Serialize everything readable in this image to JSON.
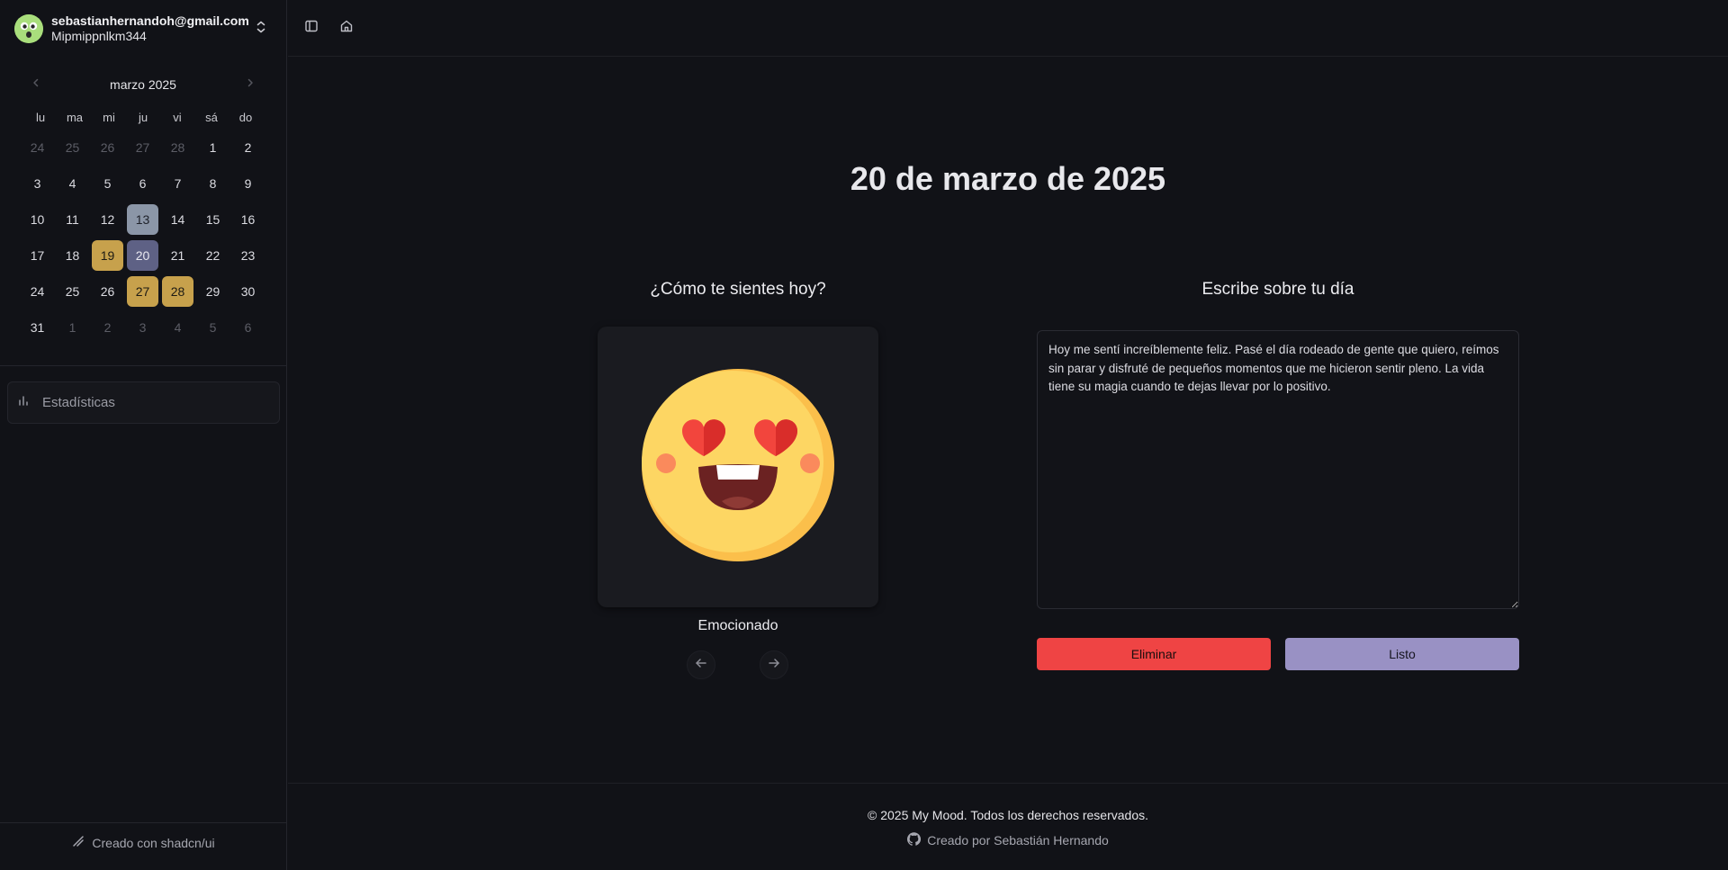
{
  "account": {
    "email": "sebastianhernandoh@gmail.com",
    "username": "Mipmippnlkm344"
  },
  "calendar": {
    "month_label": "marzo 2025",
    "weekdays": [
      "lu",
      "ma",
      "mi",
      "ju",
      "vi",
      "sá",
      "do"
    ],
    "days": [
      {
        "n": "24",
        "out": true
      },
      {
        "n": "25",
        "out": true
      },
      {
        "n": "26",
        "out": true
      },
      {
        "n": "27",
        "out": true
      },
      {
        "n": "28",
        "out": true
      },
      {
        "n": "1"
      },
      {
        "n": "2"
      },
      {
        "n": "3"
      },
      {
        "n": "4"
      },
      {
        "n": "5"
      },
      {
        "n": "6"
      },
      {
        "n": "7"
      },
      {
        "n": "8"
      },
      {
        "n": "9"
      },
      {
        "n": "10"
      },
      {
        "n": "11"
      },
      {
        "n": "12"
      },
      {
        "n": "13",
        "mood": "gray"
      },
      {
        "n": "14"
      },
      {
        "n": "15"
      },
      {
        "n": "16"
      },
      {
        "n": "17"
      },
      {
        "n": "18"
      },
      {
        "n": "19",
        "mood": "gold"
      },
      {
        "n": "20",
        "mood": "selected"
      },
      {
        "n": "21"
      },
      {
        "n": "22"
      },
      {
        "n": "23"
      },
      {
        "n": "24"
      },
      {
        "n": "25"
      },
      {
        "n": "26"
      },
      {
        "n": "27",
        "mood": "gold"
      },
      {
        "n": "28",
        "mood": "gold"
      },
      {
        "n": "29"
      },
      {
        "n": "30"
      },
      {
        "n": "31"
      },
      {
        "n": "1",
        "out": true
      },
      {
        "n": "2",
        "out": true
      },
      {
        "n": "3",
        "out": true
      },
      {
        "n": "4",
        "out": true
      },
      {
        "n": "5",
        "out": true
      },
      {
        "n": "6",
        "out": true
      }
    ],
    "mood_colors": {
      "gold": "#c7a14c",
      "gray": "#8b96a7",
      "selected": "#5e6185"
    }
  },
  "sidebar": {
    "stats_label": "Estadísticas",
    "made_with": "Creado con shadcn/ui"
  },
  "main": {
    "date_title": "20 de marzo de 2025",
    "mood_question": "¿Cómo te sientes hoy?",
    "mood_label": "Emocionado",
    "mood_icon": "heart-eyes-emoji",
    "write_title": "Escribe sobre tu día",
    "journal_text": "Hoy me sentí increíblemente feliz. Pasé el día rodeado de gente que quiero, reímos sin parar y disfruté de pequeños momentos que me hicieron sentir pleno. La vida tiene su magia cuando te dejas llevar por lo positivo.",
    "delete_label": "Eliminar",
    "done_label": "Listo",
    "delete_color": "#ef4444",
    "done_color": "#9991c4"
  },
  "footer": {
    "copyright": "© 2025 My Mood. Todos los derechos reservados.",
    "credit": "Creado por Sebastián Hernando"
  }
}
